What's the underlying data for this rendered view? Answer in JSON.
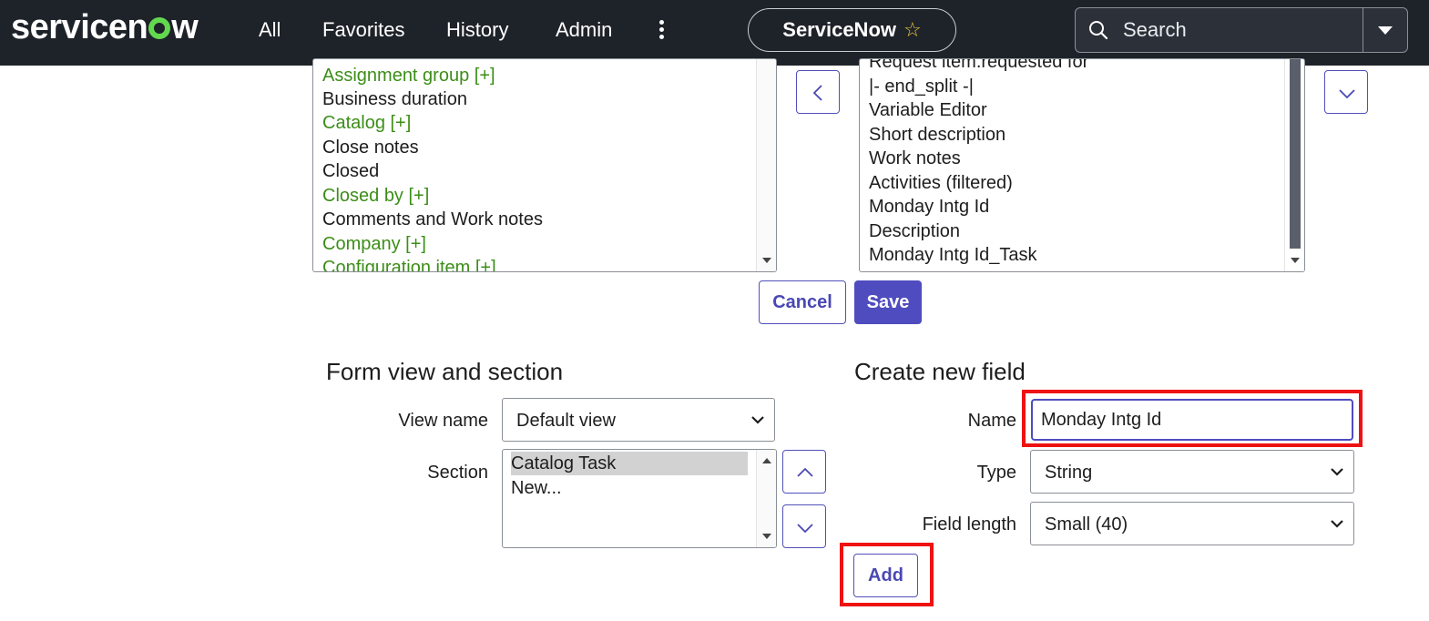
{
  "nav": {
    "logo_before": "servicen",
    "logo_after": "w",
    "items": [
      "All",
      "Favorites",
      "History",
      "Admin"
    ],
    "pill_label": "ServiceNow",
    "search_placeholder": "Search"
  },
  "available_fields": [
    {
      "label": "Assignment group [+]",
      "expandable": true
    },
    {
      "label": "Business duration",
      "expandable": false
    },
    {
      "label": "Catalog [+]",
      "expandable": true
    },
    {
      "label": "Close notes",
      "expandable": false
    },
    {
      "label": "Closed",
      "expandable": false
    },
    {
      "label": "Closed by [+]",
      "expandable": true
    },
    {
      "label": "Comments and Work notes",
      "expandable": false
    },
    {
      "label": "Company [+]",
      "expandable": true
    },
    {
      "label": "Configuration item [+]",
      "expandable": true
    }
  ],
  "selected_fields": [
    "Request item.requested for",
    "|- end_split -|",
    "Variable Editor",
    "Short description",
    "Work notes",
    "Activities (filtered)",
    "Monday Intg Id",
    "Description",
    "Monday Intg Id_Task"
  ],
  "actions": {
    "cancel": "Cancel",
    "save": "Save"
  },
  "form_view": {
    "title": "Form view and section",
    "view_name_label": "View name",
    "view_name_value": "Default view",
    "section_label": "Section",
    "sections": [
      "Catalog Task",
      "New..."
    ],
    "selected_section": "Catalog Task"
  },
  "create_field": {
    "title": "Create new field",
    "name_label": "Name",
    "name_value": "Monday Intg Id",
    "type_label": "Type",
    "type_value": "String",
    "length_label": "Field length",
    "length_value": "Small (40)",
    "add_label": "Add"
  },
  "colors": {
    "nav_bg": "#1e2229",
    "accent": "#4e4cbe",
    "expandable_field": "#3c8e18",
    "highlight": "#ee1212",
    "logo_o": "#62d84e"
  }
}
